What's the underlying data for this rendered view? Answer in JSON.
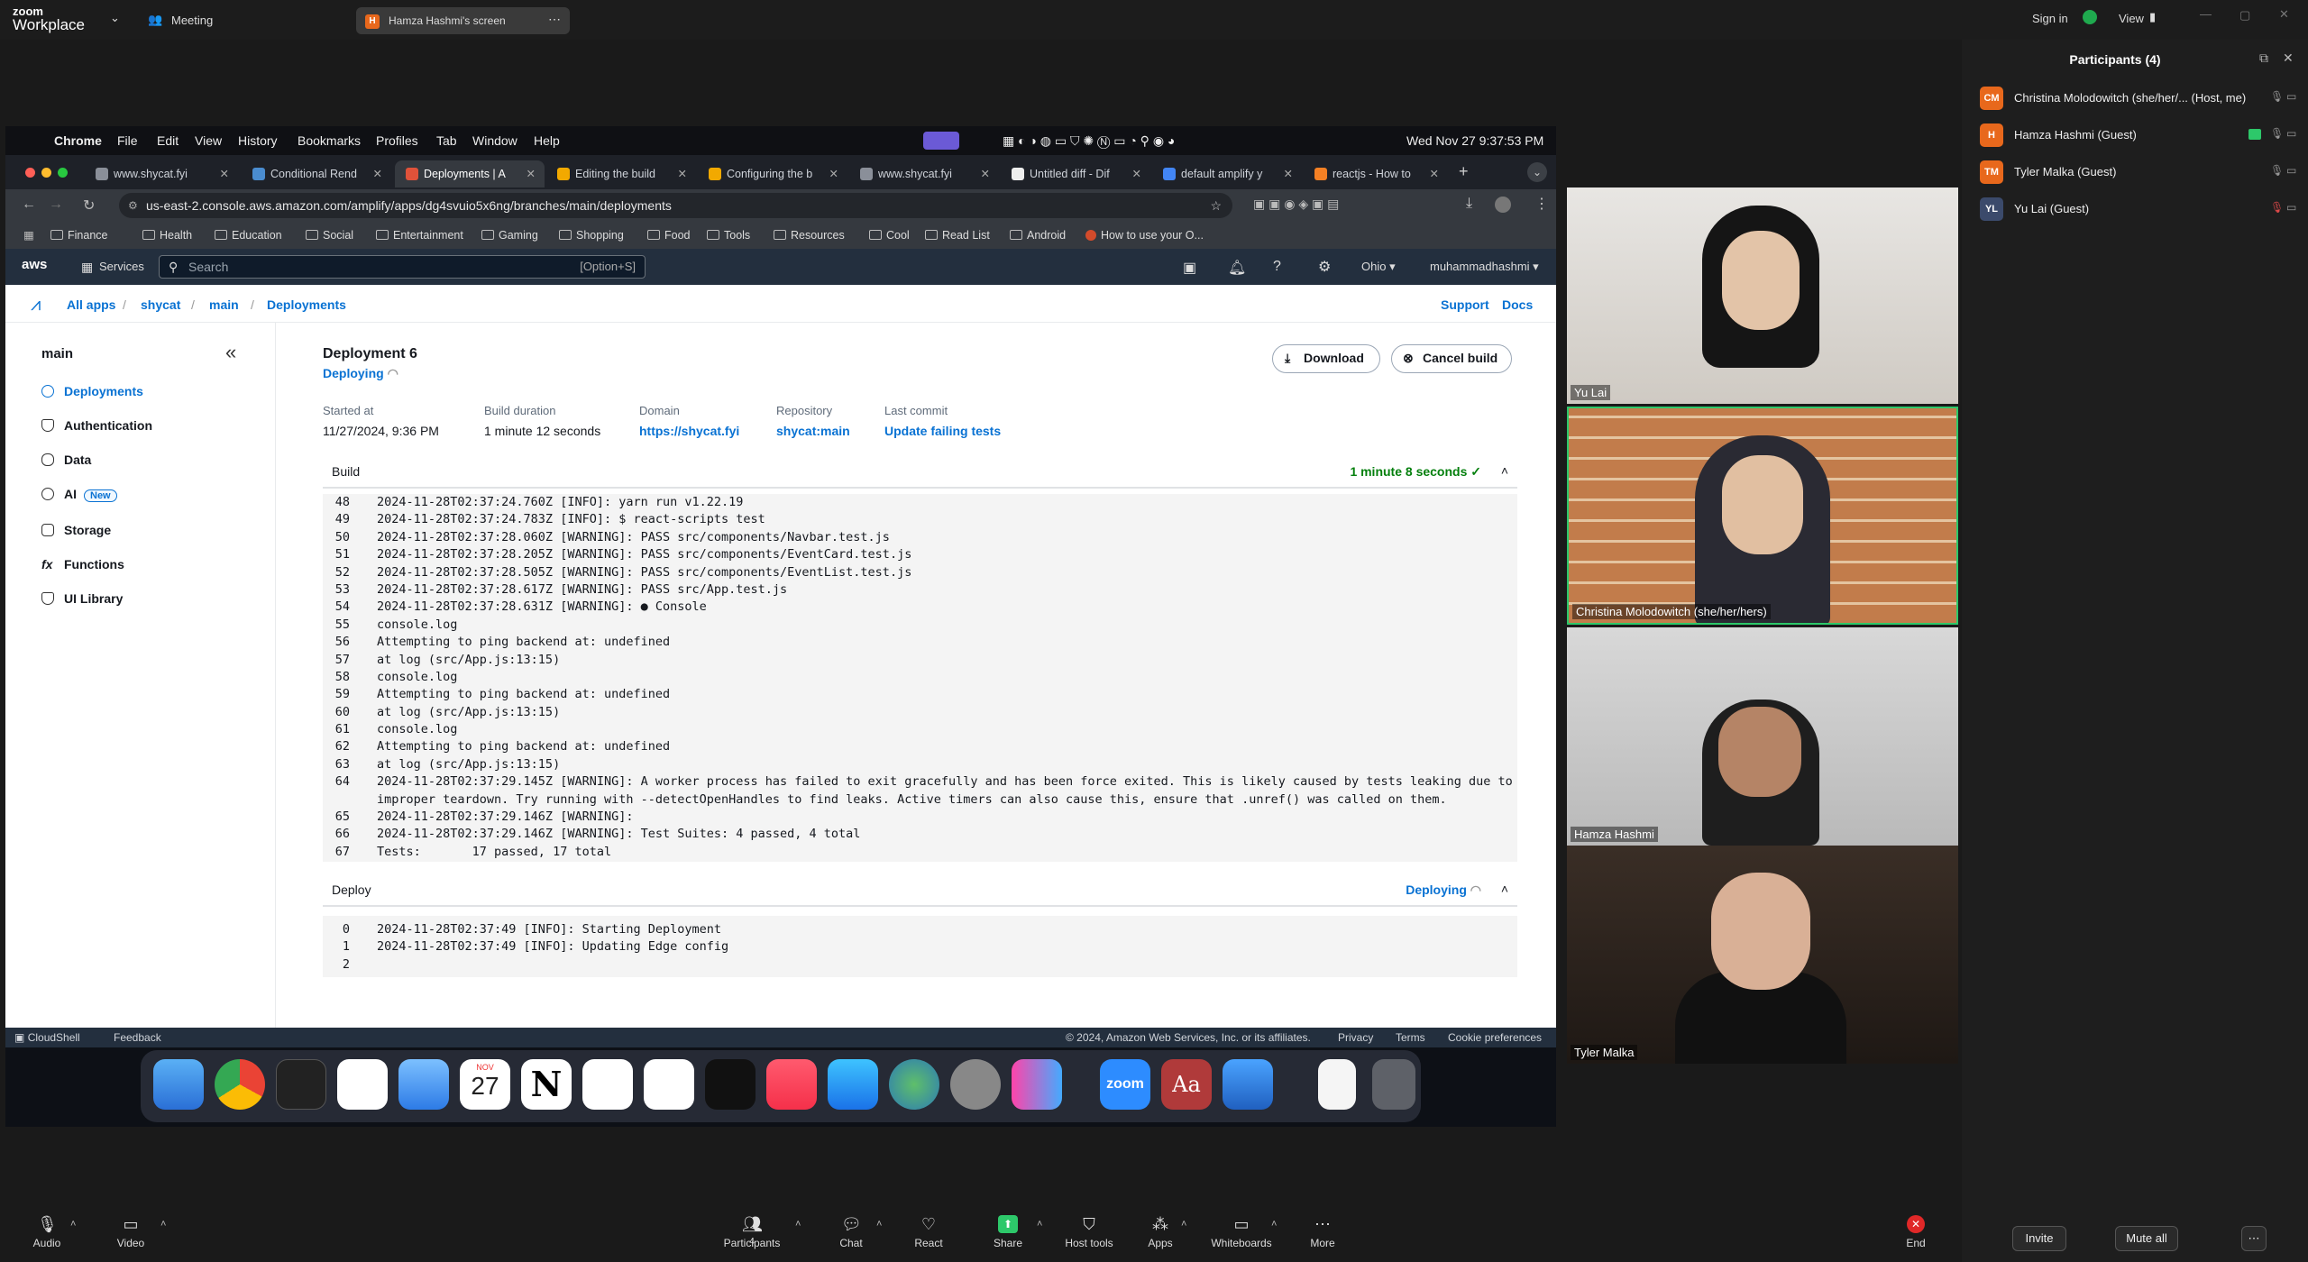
{
  "zoom": {
    "logo_line1": "zoom",
    "logo_line2": "Workplace",
    "meeting_label": "Meeting",
    "share_label": "Hamza Hashmi's screen",
    "share_avatar": "H",
    "sign_in": "Sign in",
    "view": "View"
  },
  "mac_menu": {
    "app": "Chrome",
    "items": [
      "File",
      "Edit",
      "View",
      "History",
      "Bookmarks",
      "Profiles",
      "Tab",
      "Window",
      "Help"
    ],
    "clock": "Wed Nov 27  9:37:53 PM"
  },
  "chrome": {
    "tabs": [
      {
        "label": "www.shycat.fyi",
        "active": false
      },
      {
        "label": "Conditional Rend",
        "active": false
      },
      {
        "label": "Deployments | A",
        "active": true
      },
      {
        "label": "Editing the build",
        "active": false
      },
      {
        "label": "Configuring the b",
        "active": false
      },
      {
        "label": "www.shycat.fyi",
        "active": false
      },
      {
        "label": "Untitled diff - Dif",
        "active": false
      },
      {
        "label": "default amplify y",
        "active": false
      },
      {
        "label": "reactjs - How to",
        "active": false
      }
    ],
    "url": "us-east-2.console.aws.amazon.com/amplify/apps/dg4svuio5x6ng/branches/main/deployments",
    "bookmarks": [
      "Finance",
      "Health",
      "Education",
      "Social",
      "Entertainment",
      "Gaming",
      "Shopping",
      "Food",
      "Tools",
      "Resources",
      "Cool",
      "Read List",
      "Android",
      "How to use your O..."
    ]
  },
  "aws": {
    "logo": "aws",
    "services": "Services",
    "search_placeholder": "Search",
    "search_shortcut": "[Option+S]",
    "region": "Ohio ▾",
    "account": "muhammadhashmi ▾",
    "breadcrumb": [
      "All apps",
      "shycat",
      "main",
      "Deployments"
    ],
    "support": "Support",
    "docs": "Docs",
    "sidebar": {
      "title": "main",
      "items": [
        "Deployments",
        "Authentication",
        "Data",
        "AI",
        "Storage",
        "Functions",
        "UI Library"
      ],
      "ai_badge": "New"
    },
    "deployment": {
      "title": "Deployment 6",
      "status": "Deploying",
      "download": "Download",
      "cancel": "Cancel build",
      "started_label": "Started at",
      "started_value": "11/27/2024, 9:36 PM",
      "duration_label": "Build duration",
      "duration_value": "1 minute 12 seconds",
      "domain_label": "Domain",
      "domain_value": "https://shycat.fyi",
      "repo_label": "Repository",
      "repo_value": "shycat:main",
      "commit_label": "Last commit",
      "commit_value": "Update failing tests"
    },
    "build": {
      "label": "Build",
      "status": "1 minute 8 seconds",
      "lines": [
        {
          "n": "48",
          "t": "2024-11-28T02:37:24.760Z [INFO]: yarn run v1.22.19"
        },
        {
          "n": "49",
          "t": "2024-11-28T02:37:24.783Z [INFO]: $ react-scripts test"
        },
        {
          "n": "50",
          "t": "2024-11-28T02:37:28.060Z [WARNING]: PASS src/components/Navbar.test.js"
        },
        {
          "n": "51",
          "t": "2024-11-28T02:37:28.205Z [WARNING]: PASS src/components/EventCard.test.js"
        },
        {
          "n": "52",
          "t": "2024-11-28T02:37:28.505Z [WARNING]: PASS src/components/EventList.test.js"
        },
        {
          "n": "53",
          "t": "2024-11-28T02:37:28.617Z [WARNING]: PASS src/App.test.js"
        },
        {
          "n": "54",
          "t": "2024-11-28T02:37:28.631Z [WARNING]: ● Console"
        },
        {
          "n": "55",
          "t": "console.log"
        },
        {
          "n": "56",
          "t": "Attempting to ping backend at: undefined"
        },
        {
          "n": "57",
          "t": "at log (src/App.js:13:15)"
        },
        {
          "n": "58",
          "t": "console.log"
        },
        {
          "n": "59",
          "t": "Attempting to ping backend at: undefined"
        },
        {
          "n": "60",
          "t": "at log (src/App.js:13:15)"
        },
        {
          "n": "61",
          "t": "console.log"
        },
        {
          "n": "62",
          "t": "Attempting to ping backend at: undefined"
        },
        {
          "n": "63",
          "t": "at log (src/App.js:13:15)"
        },
        {
          "n": "64",
          "t": "2024-11-28T02:37:29.145Z [WARNING]: A worker process has failed to exit gracefully and has been force exited. This is likely caused by tests leaking due to"
        },
        {
          "n": "",
          "t": "improper teardown. Try running with --detectOpenHandles to find leaks. Active timers can also cause this, ensure that .unref() was called on them."
        },
        {
          "n": "65",
          "t": "2024-11-28T02:37:29.146Z [WARNING]:"
        },
        {
          "n": "66",
          "t": "2024-11-28T02:37:29.146Z [WARNING]: Test Suites: 4 passed, 4 total"
        },
        {
          "n": "67",
          "t": "Tests:       17 passed, 17 total"
        }
      ]
    },
    "deploy": {
      "label": "Deploy",
      "status": "Deploying",
      "lines": [
        {
          "n": "0",
          "t": "2024-11-28T02:37:49 [INFO]: Starting Deployment"
        },
        {
          "n": "1",
          "t": "2024-11-28T02:37:49 [INFO]: Updating Edge config"
        },
        {
          "n": "2",
          "t": ""
        }
      ]
    },
    "footer": {
      "cloudshell": "CloudShell",
      "feedback": "Feedback",
      "copyright": "© 2024, Amazon Web Services, Inc. or its affiliates.",
      "privacy": "Privacy",
      "terms": "Terms",
      "cookies": "Cookie preferences"
    }
  },
  "dock": {
    "calendar_month": "NOV",
    "calendar_day": "27",
    "zoom_label": "zoom",
    "dictionary_label": "Aa"
  },
  "videos": [
    {
      "name": "Yu Lai"
    },
    {
      "name": "Christina Molodowitch (she/her/hers)"
    },
    {
      "name": "Hamza Hashmi"
    },
    {
      "name": "Tyler Malka"
    }
  ],
  "participants": {
    "title": "Participants (4)",
    "list": [
      {
        "initials": "CM",
        "name": "Christina Molodowitch (she/her/...  (Host, me)",
        "color": "#e8681c"
      },
      {
        "initials": "H",
        "name": "Hamza Hashmi (Guest)",
        "color": "#e8681c"
      },
      {
        "initials": "TM",
        "name": "Tyler Malka (Guest)",
        "color": "#e8681c"
      },
      {
        "initials": "YL",
        "name": "Yu Lai (Guest)",
        "color": "#3b4a6b"
      }
    ],
    "invite": "Invite",
    "mute_all": "Mute all"
  },
  "toolbar": {
    "audio": "Audio",
    "video": "Video",
    "participants": "Participants",
    "participants_count": "4",
    "chat": "Chat",
    "react": "React",
    "share": "Share",
    "host_tools": "Host tools",
    "apps": "Apps",
    "whiteboards": "Whiteboards",
    "more": "More",
    "end": "End"
  }
}
